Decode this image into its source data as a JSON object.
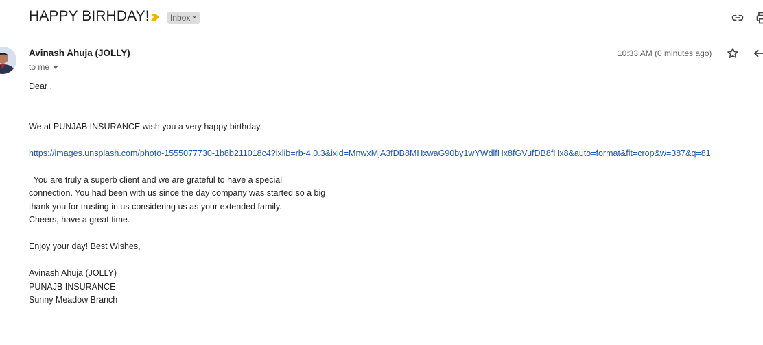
{
  "subject": "HAPPY BIRHDAY!",
  "label": {
    "name": "Inbox",
    "remove": "×"
  },
  "sender": {
    "name": "Avinash Ahuja (JOLLY)",
    "recipient": "to me"
  },
  "timestamp": "10:33 AM (0 minutes ago)",
  "icons": {
    "importance": "importance-marker-icon",
    "link": "link-icon",
    "print": "print-icon",
    "star": "star-icon",
    "reply": "reply-icon",
    "caret": "chevron-down-icon"
  },
  "colors": {
    "link": "#1a55b5",
    "importance": "#f2b400",
    "chip_bg": "#dddddd"
  },
  "body": {
    "greeting": "Dear ,",
    "intro": "We at PUNJAB INSURANCE wish you a very happy birthday.",
    "link": "https://images.unsplash.com/photo-1555077730-1b8b211018c4?ixlib=rb-4.0.3&ixid=MnwxMjA3fDB8MHxwaG90by1wYWdlfHx8fGVufDB8fHx8&auto=format&fit=crop&w=387&q=81",
    "paragraph_lines": [
      "  You are truly a superb client and we are grateful to have a special",
      "connection. You had been with us since the day company was started so a big",
      "thank you for trusting in us considering us as your extended family.",
      "Cheers, have a great time."
    ],
    "wishes": "Enjoy your day! Best Wishes,",
    "signature": [
      "Avinash Ahuja (JOLLY)",
      "PUNAJB INSURANCE",
      "Sunny Meadow Branch"
    ]
  }
}
